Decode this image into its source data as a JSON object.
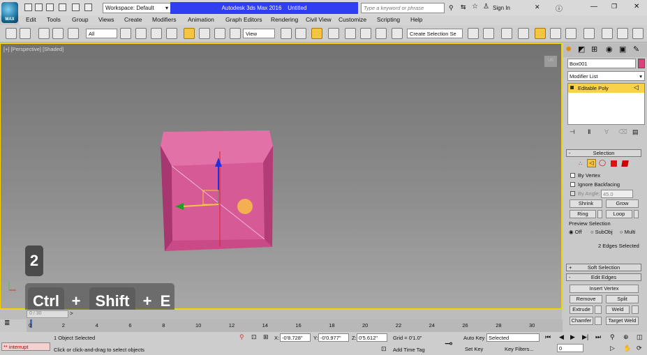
{
  "app": {
    "title": "Autodesk 3ds Max 2016",
    "doc": "Untitled",
    "logo": "MAX"
  },
  "workspace": "Workspace: Default",
  "search_placeholder": "Type a keyword or phrase",
  "signin": "Sign In",
  "menu": [
    "Edit",
    "Tools",
    "Group",
    "Views",
    "Create",
    "Modifiers",
    "Animation",
    "Graph Editors",
    "Rendering",
    "Civil View",
    "Customize",
    "Scripting",
    "Help"
  ],
  "toolbar": {
    "filter": "All",
    "refcoord": "View",
    "selset": "Create Selection Se"
  },
  "viewport": {
    "label": "[+] [Perspective] [Shaded]",
    "cube": "UB"
  },
  "keys": {
    "step": "2",
    "k1": "Ctrl",
    "plus1": "+",
    "k2": "Shift",
    "plus2": "+",
    "k3": "E"
  },
  "panel": {
    "objname": "Box001",
    "modlist": "Modifier List",
    "stackitem": "Editable Poly",
    "selection": "Selection",
    "byvertex": "By Vertex",
    "ignoreback": "Ignore Backfacing",
    "byangle": "By Angle:",
    "angle": "45.0",
    "shrink": "Shrink",
    "grow": "Grow",
    "ring": "Ring",
    "loop": "Loop",
    "preview": "Preview Selection",
    "off": "Off",
    "subobj": "SubObj",
    "multi": "Multi",
    "selcount": "2 Edges Selected",
    "softsel": "Soft Selection",
    "editedges": "Edit Edges",
    "insertvertex": "Insert Vertex",
    "remove": "Remove",
    "split": "Split",
    "extrude": "Extrude",
    "weld": "Weld",
    "chamfer": "Chamfer",
    "targetweld": "Target Weld"
  },
  "timeline": {
    "frame": "0 / 30",
    "ticks": [
      "0",
      "2",
      "4",
      "6",
      "8",
      "10",
      "12",
      "14",
      "16",
      "18",
      "20",
      "22",
      "24",
      "26",
      "28",
      "30"
    ]
  },
  "status": {
    "script": "** interrupt",
    "selected": "1 Object Selected",
    "prompt": "Click or click-and-drag to select objects",
    "x": "-0'8.728\"",
    "y": "-0'0.977\"",
    "z": "0'5.612\"",
    "grid": "Grid = 0'1.0\"",
    "addtimetag": "Add Time Tag",
    "autokey": "Auto Key",
    "setkey": "Set Key",
    "selectedset": "Selected",
    "keyfilters": "Key Filters...",
    "frame": "0"
  },
  "colors": {
    "accent": "#f5c542",
    "title": "#2f3ef0",
    "object": "#d8447a"
  }
}
